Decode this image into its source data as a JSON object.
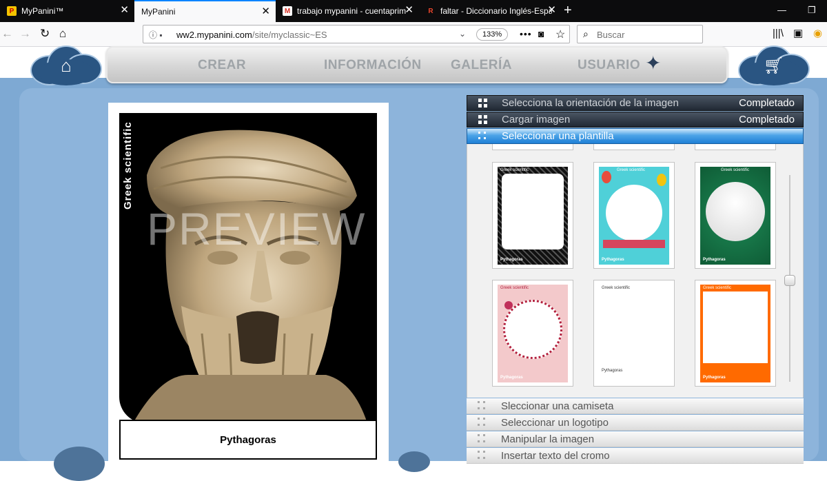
{
  "browser": {
    "tabs": [
      {
        "title": "MyPanini™",
        "favicon": "panini-logo-icon",
        "active": false
      },
      {
        "title": "MyPanini",
        "favicon": "none",
        "active": true
      },
      {
        "title": "trabajo mypanini - cuentaprim",
        "favicon": "gmail-icon",
        "active": false
      },
      {
        "title": "faltar - Diccionario Inglés-Espa",
        "favicon": "wordreference-icon",
        "active": false
      }
    ],
    "url_host": "ww2.mypanini.com",
    "url_path": "/site/myclassic~ES",
    "zoom": "133%",
    "search_placeholder": "Buscar"
  },
  "site": {
    "menu": [
      "CREAR",
      "INFORMACIÓN",
      "GALERÍA",
      "USUARIO"
    ],
    "colors": {
      "cloud": "#2a5582",
      "background": "#7ea9d3",
      "active_step": "#1f7fd6"
    }
  },
  "card": {
    "category": "Greek scientific",
    "watermark": "PREVIEW",
    "name": "Pythagoras"
  },
  "wizard": {
    "steps_top": [
      {
        "label": "Selecciona la orientación de la imagen",
        "status": "Completado"
      },
      {
        "label": "Cargar imagen",
        "status": "Completado"
      },
      {
        "label": "Seleccionar una plantilla",
        "status": ""
      }
    ],
    "templates": [
      {
        "style": "black-pattern",
        "top": "Greek scientific",
        "bottom": "Pythagoras"
      },
      {
        "style": "birthday-balloons",
        "top": "Greek scientific",
        "bottom": "Pythagoras"
      },
      {
        "style": "green-christmas",
        "top": "Greek scientific",
        "bottom": "Pythagoras"
      },
      {
        "style": "pink-flowers",
        "top": "Greek scientific",
        "bottom": "Pythagoras"
      },
      {
        "style": "plain-white",
        "top": "Greek scientific",
        "bottom": "Pythagoras"
      },
      {
        "style": "orange-frame",
        "top": "Greek scientific",
        "bottom": "Pythagoras"
      }
    ],
    "steps_bottom": [
      "Sleccionar una camiseta",
      "Seleccionar un logotipo",
      "Manipular la imagen",
      "Insertar texto del cromo"
    ]
  }
}
